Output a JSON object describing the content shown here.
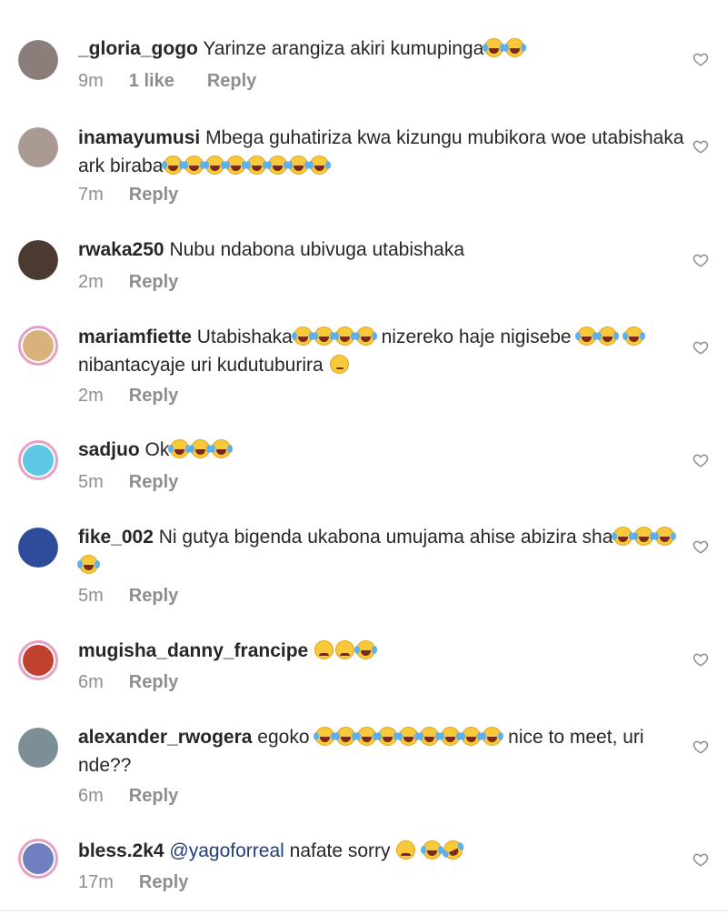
{
  "comments": [
    {
      "username": "_gloria_gogo",
      "text": "Yarinze arangiza akiri kumupinga",
      "emojis": [
        "tears",
        "tears"
      ],
      "time": "9m",
      "likes": "1 like",
      "reply": "Reply",
      "avatar_color": "#8a7d7a"
    },
    {
      "username": "inamayumusi",
      "text": "Mbega guhatiriza kwa kizungu mubikora woe utabishaka ark biraba",
      "emojis": [
        "tears",
        "tears",
        "tears",
        "tears",
        "tears",
        "tears",
        "tears",
        "tears"
      ],
      "time": "7m",
      "reply": "Reply",
      "avatar_color": "#a99a93"
    },
    {
      "username": "rwaka250",
      "text": "Nubu ndabona ubivuga utabishaka",
      "emojis": [],
      "time": "2m",
      "reply": "Reply",
      "avatar_color": "#4a3a30"
    },
    {
      "username": "mariamfiette",
      "text": "Utabishaka",
      "emojis": [
        "tears",
        "tears",
        "tears",
        "tears"
      ],
      "text2": " nizereko haje nigisebe ",
      "emojis2": [
        "tears",
        "tears"
      ],
      "text3": " ",
      "emojis3": [
        "tears"
      ],
      "text4": " nibantacyaje uri kudutuburira ",
      "emojis4": [
        "roll"
      ],
      "time": "2m",
      "reply": "Reply",
      "avatar_color": "#d9b17a"
    },
    {
      "username": "sadjuo",
      "text": "Ok",
      "emojis": [
        "tears",
        "tears",
        "tears"
      ],
      "time": "5m",
      "reply": "Reply",
      "avatar_color": "#5fc7e6"
    },
    {
      "username": "fike_002",
      "text": "Ni gutya bigenda ukabona umujama ahise abizira sha",
      "emojis": [
        "tears",
        "tears",
        "tears",
        "tears"
      ],
      "time": "5m",
      "reply": "Reply",
      "avatar_color": "#2d4c9a"
    },
    {
      "username": "mugisha_danny_francipe",
      "text": "",
      "emojis": [
        "sad",
        "sad",
        "tears"
      ],
      "time": "6m",
      "reply": "Reply",
      "avatar_color": "#c0412d"
    },
    {
      "username": "alexander_rwogera",
      "text": "egoko ",
      "emojis": [
        "tears",
        "tears",
        "tears",
        "tears",
        "tears",
        "tears",
        "tears",
        "tears",
        "tears"
      ],
      "text2": " nice to meet, uri nde??",
      "time": "6m",
      "reply": "Reply",
      "avatar_color": "#7d8f96"
    },
    {
      "username": "bless.2k4",
      "mention": "@yagoforreal",
      "text": " nafate sorry ",
      "emojis": [
        "sad"
      ],
      "text2": " ",
      "emojis2": [
        "tears",
        "rofl"
      ],
      "time": "17m",
      "reply": "Reply",
      "avatar_color": "#6f7fc0"
    }
  ],
  "colors": {
    "ring": "#e6a0c4",
    "meta": "#8e8e8e",
    "mention": "#1f3f78"
  },
  "icons": {
    "like": "heart-outline-icon"
  }
}
